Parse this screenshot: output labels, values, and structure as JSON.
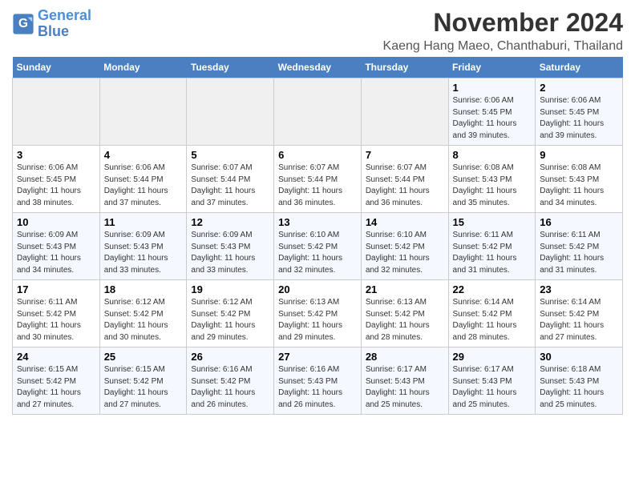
{
  "logo": {
    "line1": "General",
    "line2": "Blue"
  },
  "title": "November 2024",
  "subtitle": "Kaeng Hang Maeo, Chanthaburi, Thailand",
  "weekdays": [
    "Sunday",
    "Monday",
    "Tuesday",
    "Wednesday",
    "Thursday",
    "Friday",
    "Saturday"
  ],
  "weeks": [
    [
      {
        "day": "",
        "info": ""
      },
      {
        "day": "",
        "info": ""
      },
      {
        "day": "",
        "info": ""
      },
      {
        "day": "",
        "info": ""
      },
      {
        "day": "",
        "info": ""
      },
      {
        "day": "1",
        "info": "Sunrise: 6:06 AM\nSunset: 5:45 PM\nDaylight: 11 hours and 39 minutes."
      },
      {
        "day": "2",
        "info": "Sunrise: 6:06 AM\nSunset: 5:45 PM\nDaylight: 11 hours and 39 minutes."
      }
    ],
    [
      {
        "day": "3",
        "info": "Sunrise: 6:06 AM\nSunset: 5:45 PM\nDaylight: 11 hours and 38 minutes."
      },
      {
        "day": "4",
        "info": "Sunrise: 6:06 AM\nSunset: 5:44 PM\nDaylight: 11 hours and 37 minutes."
      },
      {
        "day": "5",
        "info": "Sunrise: 6:07 AM\nSunset: 5:44 PM\nDaylight: 11 hours and 37 minutes."
      },
      {
        "day": "6",
        "info": "Sunrise: 6:07 AM\nSunset: 5:44 PM\nDaylight: 11 hours and 36 minutes."
      },
      {
        "day": "7",
        "info": "Sunrise: 6:07 AM\nSunset: 5:44 PM\nDaylight: 11 hours and 36 minutes."
      },
      {
        "day": "8",
        "info": "Sunrise: 6:08 AM\nSunset: 5:43 PM\nDaylight: 11 hours and 35 minutes."
      },
      {
        "day": "9",
        "info": "Sunrise: 6:08 AM\nSunset: 5:43 PM\nDaylight: 11 hours and 34 minutes."
      }
    ],
    [
      {
        "day": "10",
        "info": "Sunrise: 6:09 AM\nSunset: 5:43 PM\nDaylight: 11 hours and 34 minutes."
      },
      {
        "day": "11",
        "info": "Sunrise: 6:09 AM\nSunset: 5:43 PM\nDaylight: 11 hours and 33 minutes."
      },
      {
        "day": "12",
        "info": "Sunrise: 6:09 AM\nSunset: 5:43 PM\nDaylight: 11 hours and 33 minutes."
      },
      {
        "day": "13",
        "info": "Sunrise: 6:10 AM\nSunset: 5:42 PM\nDaylight: 11 hours and 32 minutes."
      },
      {
        "day": "14",
        "info": "Sunrise: 6:10 AM\nSunset: 5:42 PM\nDaylight: 11 hours and 32 minutes."
      },
      {
        "day": "15",
        "info": "Sunrise: 6:11 AM\nSunset: 5:42 PM\nDaylight: 11 hours and 31 minutes."
      },
      {
        "day": "16",
        "info": "Sunrise: 6:11 AM\nSunset: 5:42 PM\nDaylight: 11 hours and 31 minutes."
      }
    ],
    [
      {
        "day": "17",
        "info": "Sunrise: 6:11 AM\nSunset: 5:42 PM\nDaylight: 11 hours and 30 minutes."
      },
      {
        "day": "18",
        "info": "Sunrise: 6:12 AM\nSunset: 5:42 PM\nDaylight: 11 hours and 30 minutes."
      },
      {
        "day": "19",
        "info": "Sunrise: 6:12 AM\nSunset: 5:42 PM\nDaylight: 11 hours and 29 minutes."
      },
      {
        "day": "20",
        "info": "Sunrise: 6:13 AM\nSunset: 5:42 PM\nDaylight: 11 hours and 29 minutes."
      },
      {
        "day": "21",
        "info": "Sunrise: 6:13 AM\nSunset: 5:42 PM\nDaylight: 11 hours and 28 minutes."
      },
      {
        "day": "22",
        "info": "Sunrise: 6:14 AM\nSunset: 5:42 PM\nDaylight: 11 hours and 28 minutes."
      },
      {
        "day": "23",
        "info": "Sunrise: 6:14 AM\nSunset: 5:42 PM\nDaylight: 11 hours and 27 minutes."
      }
    ],
    [
      {
        "day": "24",
        "info": "Sunrise: 6:15 AM\nSunset: 5:42 PM\nDaylight: 11 hours and 27 minutes."
      },
      {
        "day": "25",
        "info": "Sunrise: 6:15 AM\nSunset: 5:42 PM\nDaylight: 11 hours and 27 minutes."
      },
      {
        "day": "26",
        "info": "Sunrise: 6:16 AM\nSunset: 5:42 PM\nDaylight: 11 hours and 26 minutes."
      },
      {
        "day": "27",
        "info": "Sunrise: 6:16 AM\nSunset: 5:43 PM\nDaylight: 11 hours and 26 minutes."
      },
      {
        "day": "28",
        "info": "Sunrise: 6:17 AM\nSunset: 5:43 PM\nDaylight: 11 hours and 25 minutes."
      },
      {
        "day": "29",
        "info": "Sunrise: 6:17 AM\nSunset: 5:43 PM\nDaylight: 11 hours and 25 minutes."
      },
      {
        "day": "30",
        "info": "Sunrise: 6:18 AM\nSunset: 5:43 PM\nDaylight: 11 hours and 25 minutes."
      }
    ]
  ]
}
